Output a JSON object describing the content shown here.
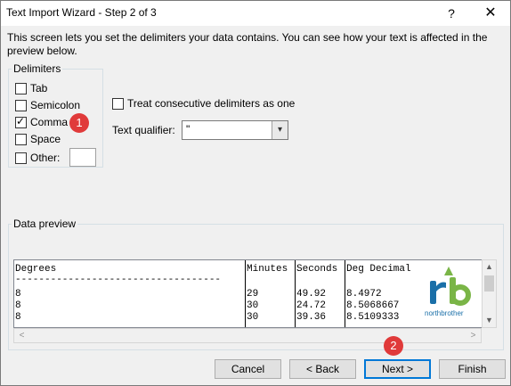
{
  "window": {
    "title": "Text Import Wizard - Step 2 of 3",
    "help_glyph": "?",
    "close_glyph": "✕"
  },
  "intro_text": "This screen lets you set the delimiters your data contains.  You can see how your text is affected in the preview below.",
  "delimiters": {
    "group_label": "Delimiters",
    "tab": {
      "label": "Tab",
      "checked": false
    },
    "semicolon": {
      "label": "Semicolon",
      "checked": false
    },
    "comma": {
      "label": "Comma",
      "checked": true
    },
    "space": {
      "label": "Space",
      "checked": false
    },
    "other": {
      "label": "Other:",
      "checked": false,
      "value": ""
    }
  },
  "consecutive": {
    "label": "Treat consecutive delimiters as one",
    "checked": false
  },
  "text_qualifier": {
    "label": "Text qualifier:",
    "value": "\"",
    "arrow_glyph": "▾"
  },
  "badges": {
    "one": "1",
    "two": "2"
  },
  "preview": {
    "group_label": "Data preview",
    "columns": [
      "Degrees",
      "Minutes",
      "Seconds",
      "Deg Decimal"
    ],
    "separator": "-----------------------------------",
    "rows": [
      [
        "8",
        "29",
        "49.92",
        "8.4972"
      ],
      [
        "8",
        "30",
        "24.72",
        "8.5068667"
      ],
      [
        "8",
        "30",
        "39.36",
        "8.5109333"
      ]
    ],
    "logo_text": "northbrother"
  },
  "scroll": {
    "up": "▲",
    "down": "▼",
    "left": "<",
    "right": ">"
  },
  "buttons": {
    "cancel": "Cancel",
    "back": "< Back",
    "next": "Next >",
    "finish": "Finish"
  },
  "colors": {
    "badge": "#e03a3a",
    "default_button_border": "#0078d7",
    "logo_green": "#7ab547",
    "logo_blue": "#1a6fa8"
  }
}
